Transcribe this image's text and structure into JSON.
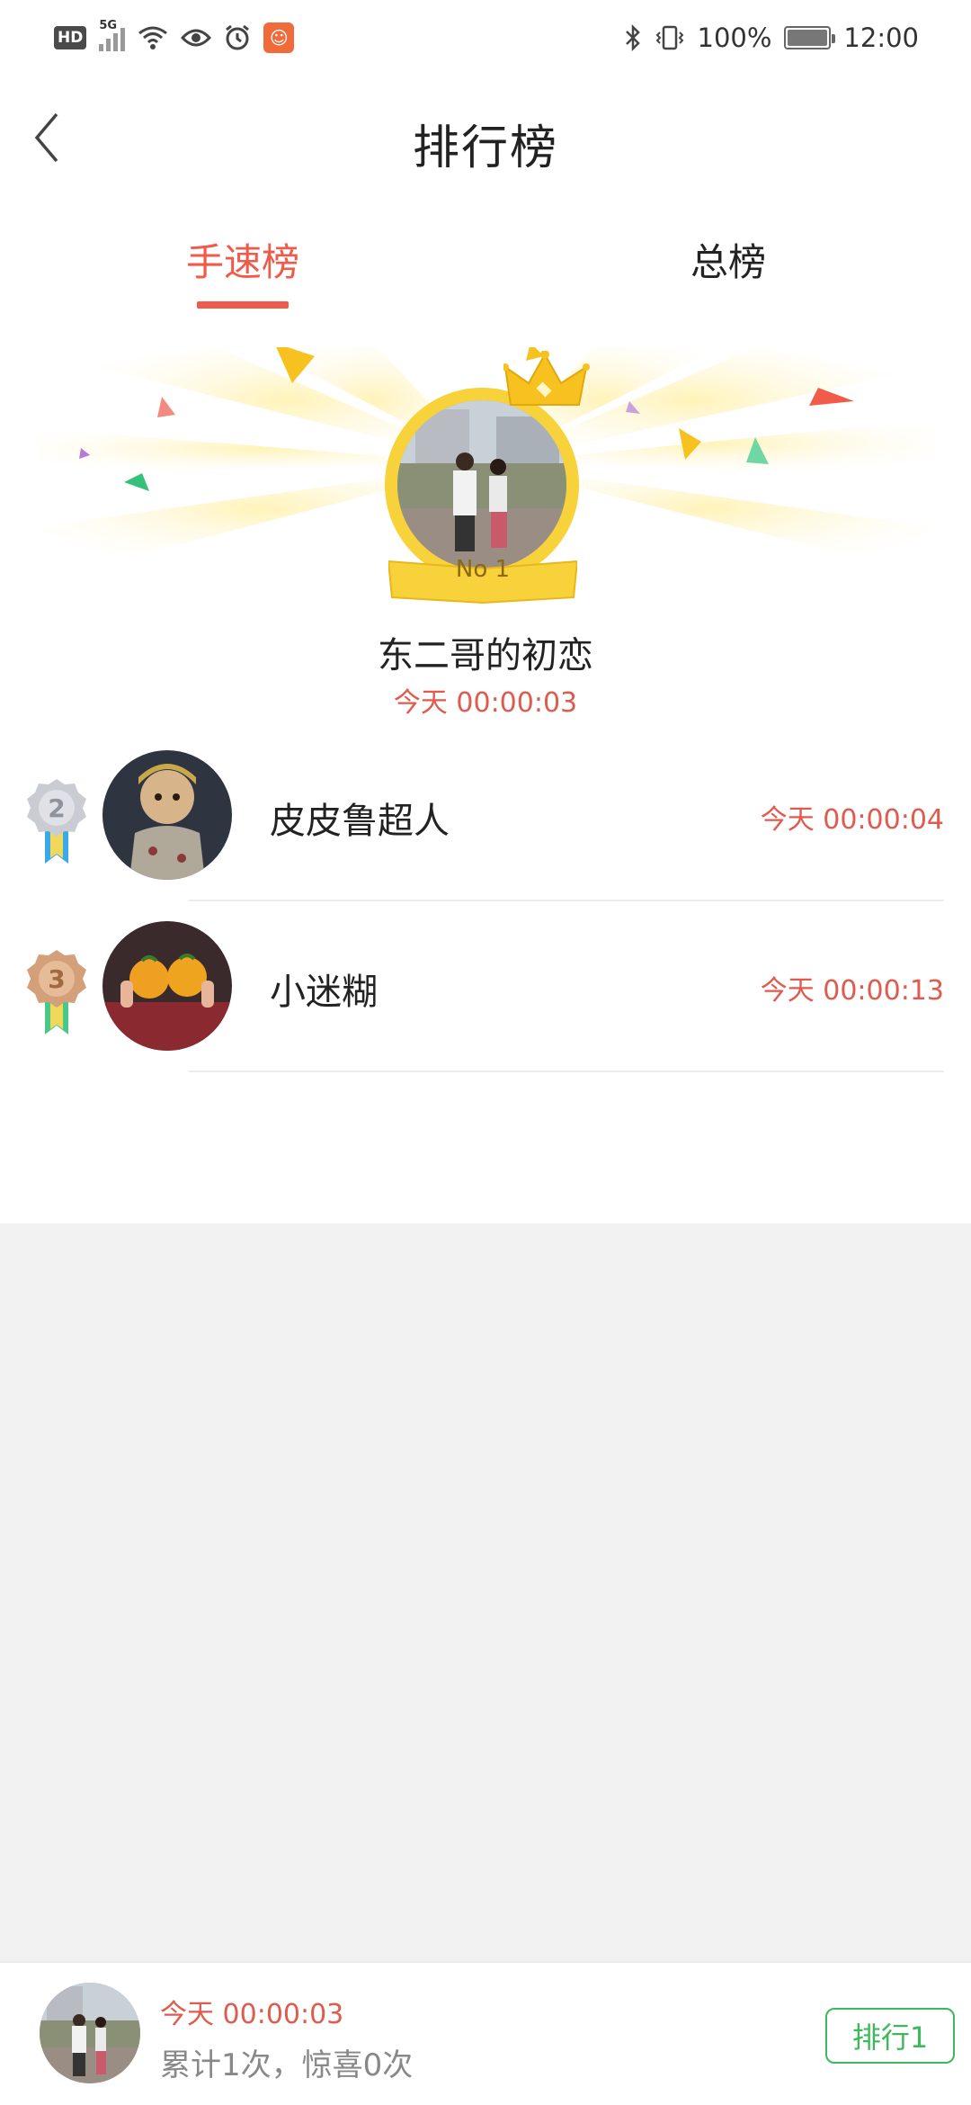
{
  "status_bar": {
    "hd": "HD",
    "network": "5G",
    "battery": "100%",
    "time": "12:00"
  },
  "header": {
    "title": "排行榜"
  },
  "tabs": [
    {
      "label": "手速榜",
      "active": true
    },
    {
      "label": "总榜",
      "active": false
    }
  ],
  "champion": {
    "badge": "No 1",
    "name": "东二哥的初恋",
    "time": "今天 00:00:03"
  },
  "rankings": [
    {
      "rank": "2",
      "name": "皮皮鲁超人",
      "time": "今天 00:00:04"
    },
    {
      "rank": "3",
      "name": "小迷糊",
      "time": "今天 00:00:13"
    }
  ],
  "bottom_bar": {
    "time": "今天 00:00:03",
    "stats": "累计1次，惊喜0次",
    "rank_button": "排行1"
  },
  "colors": {
    "accent": "#ef5a4b",
    "time_red": "#e05a4e",
    "rank_button_green": "#3cb95a",
    "champion_gold": "#f7d23a",
    "silver": "#c9ccd3",
    "bronze": "#d4a07a"
  }
}
